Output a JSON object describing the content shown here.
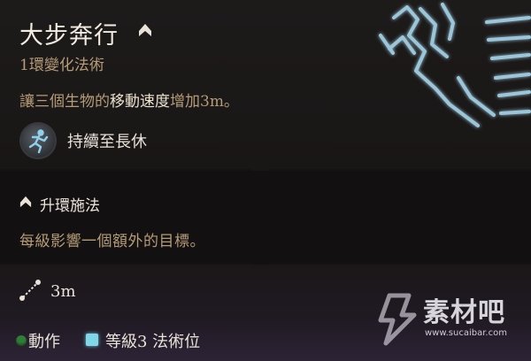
{
  "spell": {
    "name": "大步奔行",
    "school": "1環變化法術",
    "description": {
      "prefix": "讓三個生物的",
      "highlight": "移動速度",
      "suffix": "增加3m。"
    },
    "duration": "持續至長休",
    "upcast": {
      "title": "升環施法",
      "description": "每級影響一個額外的目標。"
    },
    "range": "3m",
    "cost": {
      "action": "動作",
      "slot": "等級3 法術位"
    }
  },
  "colors": {
    "action": "#2f7d37",
    "spell_slot": "#7fd7e8",
    "highlight_text": "#ece2cf",
    "muted_text": "#b69c77"
  },
  "icons": {
    "upcast": "upcast-chevron-icon",
    "duration": "running-figure-icon",
    "range": "range-line-icon",
    "spell_art": "lightning-stride-art"
  },
  "watermark": {
    "text": "素材吧",
    "url": "www.sucaibar.com"
  }
}
